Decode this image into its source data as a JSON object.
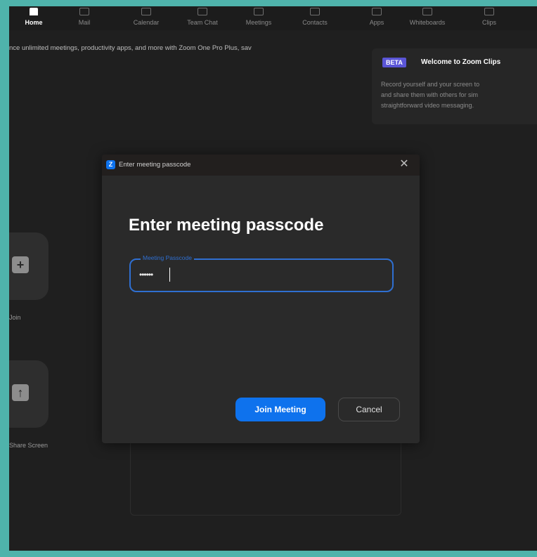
{
  "nav": {
    "items": [
      {
        "label": "Home",
        "icon": "home-icon",
        "active": true
      },
      {
        "label": "Mail",
        "icon": "mail-icon"
      },
      {
        "label": "Calendar",
        "icon": "calendar-icon"
      },
      {
        "label": "Team Chat",
        "icon": "chat-icon"
      },
      {
        "label": "Meetings",
        "icon": "video-icon"
      },
      {
        "label": "Contacts",
        "icon": "contacts-icon"
      },
      {
        "label": "Apps",
        "icon": "apps-icon"
      },
      {
        "label": "Whiteboards",
        "icon": "whiteboard-icon"
      },
      {
        "label": "Clips",
        "icon": "clips-icon"
      }
    ]
  },
  "promo": {
    "text": "nce unlimited meetings, productivity apps, and more with Zoom One Pro Plus, sav"
  },
  "clips_card": {
    "badge": "BETA",
    "title": "Welcome to Zoom Clips",
    "lines": [
      "Record yourself and your screen to",
      "and share them with others for sim",
      "straightforward video messaging."
    ]
  },
  "side": {
    "tile1_label": "Join",
    "tile2_label": "Share Screen"
  },
  "dialog": {
    "title": "Enter meeting passcode",
    "heading": "Enter meeting passcode",
    "field_label": "Meeting Passcode",
    "field_value": "••••••",
    "join_label": "Join Meeting",
    "cancel_label": "Cancel",
    "close_symbol": "✕",
    "logo_letter": "Z"
  },
  "colors": {
    "accent": "#0e72ed",
    "focus": "#2f6fd1",
    "beta": "#5a55d6",
    "backdrop": "#4fb3ab"
  }
}
